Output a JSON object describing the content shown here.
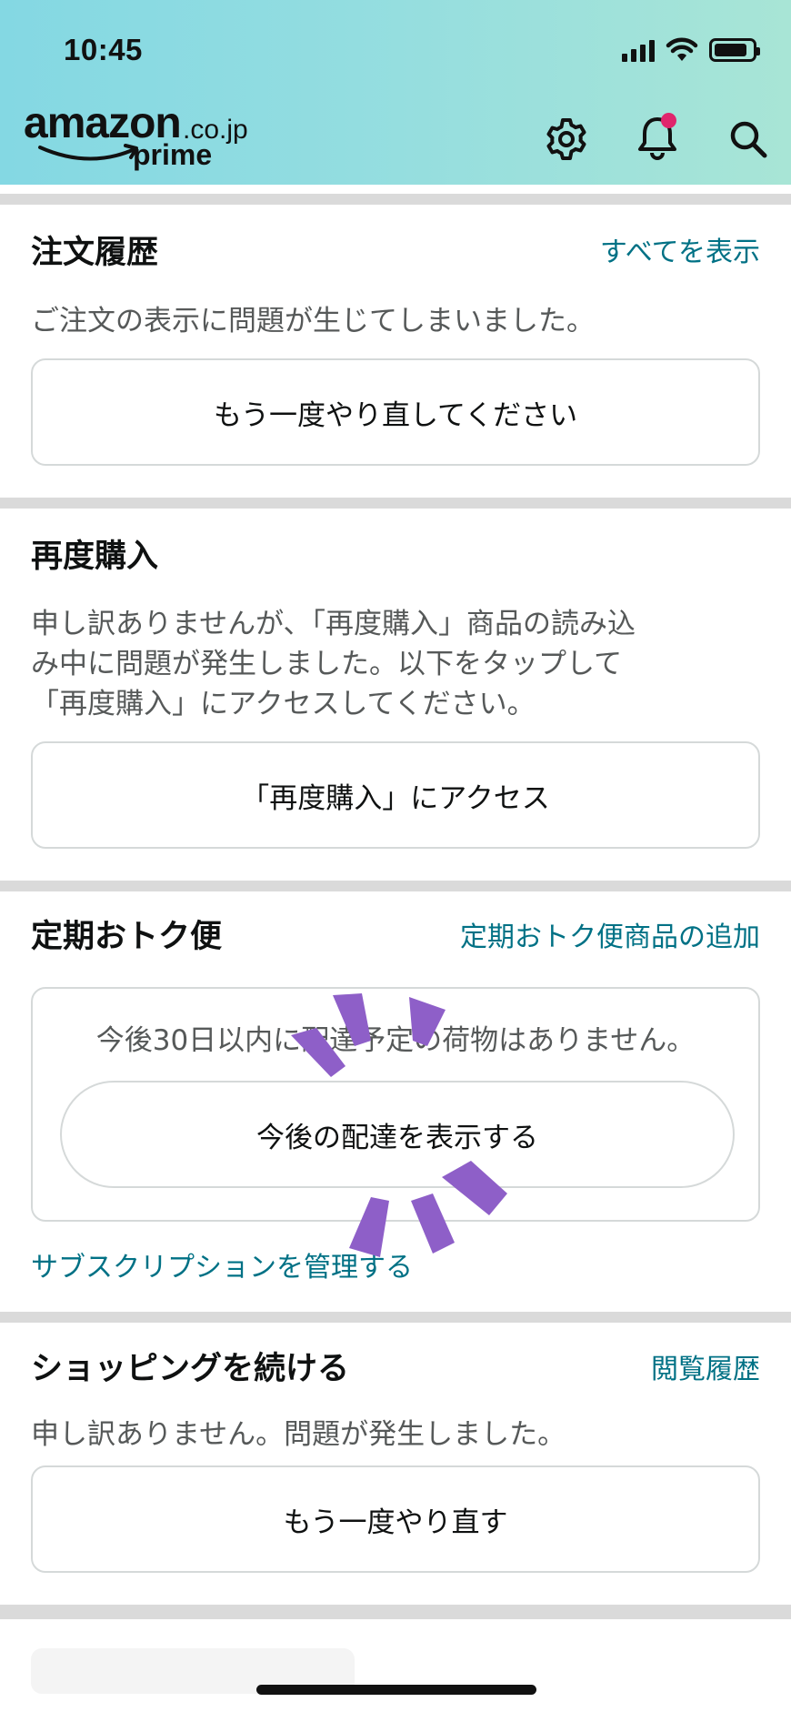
{
  "status_bar": {
    "time": "10:45"
  },
  "header": {
    "logo": {
      "brand": "amazon",
      "domain": ".co.jp",
      "tier": "prime"
    },
    "icons": [
      "gear-icon",
      "bell-icon",
      "search-icon"
    ],
    "notification_dot_color": "#e0256c"
  },
  "order_history": {
    "title": "注文履歴",
    "link": "すべてを表示",
    "message": "ご注文の表示に問題が生じてしまいました。",
    "button": "もう一度やり直してください"
  },
  "buy_again": {
    "title": "再度購入",
    "message_lines": [
      "申し訳ありませんが、「再度購入」商品の読み込",
      "み中に問題が発生しました。以下をタップして",
      "「再度購入」にアクセスしてください。"
    ],
    "button": "「再度購入」にアクセス"
  },
  "subscribe_save": {
    "title": "定期おトク便",
    "link": "定期おトク便商品の追加",
    "message": "今後30日以内に配達予定の荷物はありません。",
    "button": "今後の配達を表示する",
    "manage_link": "サブスクリプションを管理する"
  },
  "continue_shopping": {
    "title": "ショッピングを続ける",
    "link": "閲覧履歴",
    "message": "申し訳ありません。問題が発生しました。",
    "button": "もう一度やり直す"
  },
  "colors": {
    "accent_link": "#007185",
    "spinner": "#8e5fc8"
  }
}
